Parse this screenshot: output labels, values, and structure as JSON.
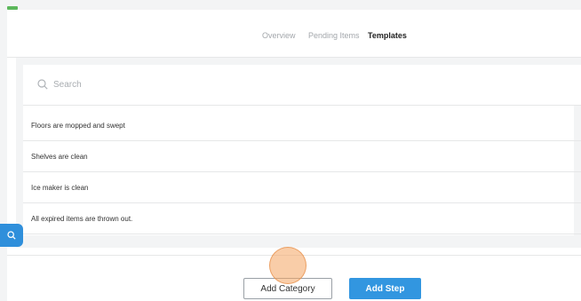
{
  "tabs": [
    {
      "label": "Overview"
    },
    {
      "label": "Pending Items"
    },
    {
      "label": "Templates"
    }
  ],
  "search": {
    "placeholder": "Search"
  },
  "items": [
    {
      "label": "Floors are mopped and swept"
    },
    {
      "label": "Shelves are clean"
    },
    {
      "label": "Ice maker is clean"
    },
    {
      "label": "All expired items are thrown out."
    }
  ],
  "buttons": {
    "add_category": "Add Category",
    "add_step": "Add Step"
  },
  "colors": {
    "accent_green": "#5cb85c",
    "primary_blue": "#3296e0",
    "click_indicator": "#f4a460"
  },
  "icons": {
    "search": "search-icon"
  }
}
